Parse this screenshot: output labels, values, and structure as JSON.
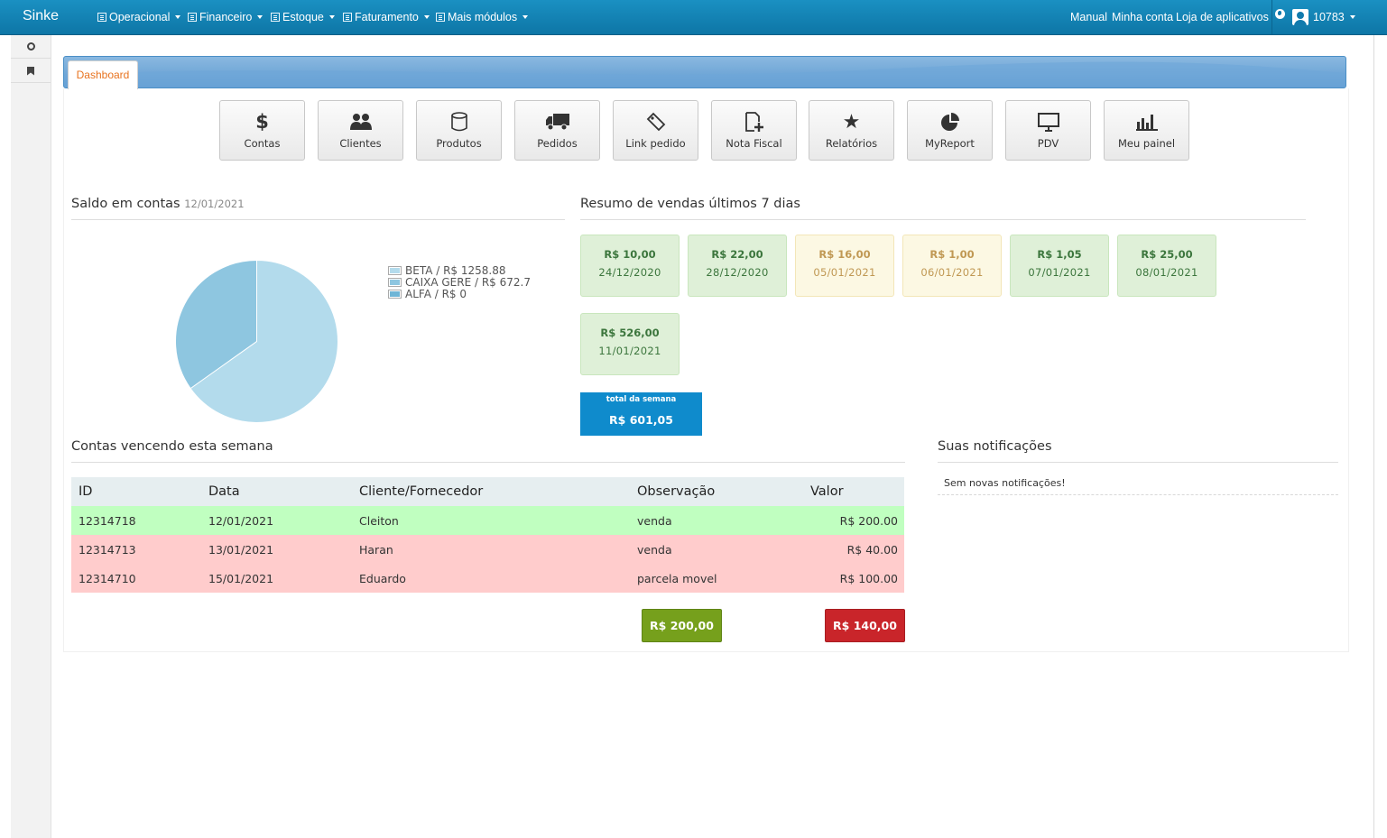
{
  "navbar": {
    "brand": "Sinke",
    "menus": [
      {
        "label": "Operacional"
      },
      {
        "label": "Financeiro"
      },
      {
        "label": "Estoque"
      },
      {
        "label": "Faturamento"
      },
      {
        "label": "Mais módulos"
      }
    ],
    "links": {
      "manual": "Manual",
      "account": "Minha conta",
      "store": "Loja de aplicativos"
    },
    "user": "10783"
  },
  "tabs": {
    "active": "Dashboard"
  },
  "shortcuts": [
    {
      "label": "Contas",
      "icon": "dollar-icon"
    },
    {
      "label": "Clientes",
      "icon": "users-icon"
    },
    {
      "label": "Produtos",
      "icon": "database-icon"
    },
    {
      "label": "Pedidos",
      "icon": "truck-icon"
    },
    {
      "label": "Link pedido",
      "icon": "tag-icon"
    },
    {
      "label": "Nota Fiscal",
      "icon": "file-plus-icon"
    },
    {
      "label": "Relatórios",
      "icon": "star-icon"
    },
    {
      "label": "MyReport",
      "icon": "pie-chart-icon"
    },
    {
      "label": "PDV",
      "icon": "monitor-icon"
    },
    {
      "label": "Meu painel",
      "icon": "bar-chart-icon"
    }
  ],
  "balance": {
    "title": "Saldo em contas",
    "date": "12/01/2021",
    "legend": [
      {
        "label": "BETA / R$ 1258.88",
        "value": 1258.88,
        "color": "#b3dbec"
      },
      {
        "label": "CAIXA GERE / R$ 672.7",
        "value": 672.7,
        "color": "#8ec6e0"
      },
      {
        "label": "ALFA / R$ 0",
        "value": 0,
        "color": "#6fb5d6"
      }
    ]
  },
  "sales": {
    "title": "Resumo de vendas últimos 7 dias",
    "days": [
      {
        "amount": "R$ 10,00",
        "date": "24/12/2020",
        "status": "green"
      },
      {
        "amount": "R$ 22,00",
        "date": "28/12/2020",
        "status": "green"
      },
      {
        "amount": "R$ 16,00",
        "date": "05/01/2021",
        "status": "yellow"
      },
      {
        "amount": "R$ 1,00",
        "date": "06/01/2021",
        "status": "yellow"
      },
      {
        "amount": "R$ 1,05",
        "date": "07/01/2021",
        "status": "green"
      },
      {
        "amount": "R$ 25,00",
        "date": "08/01/2021",
        "status": "green"
      },
      {
        "amount": "R$ 526,00",
        "date": "11/01/2021",
        "status": "green"
      }
    ],
    "week_label": "total da semana",
    "week_total": "R$ 601,05"
  },
  "bills": {
    "title": "Contas vencendo esta semana",
    "headers": {
      "id": "ID",
      "date": "Data",
      "client": "Cliente/Fornecedor",
      "note": "Observação",
      "value": "Valor"
    },
    "rows": [
      {
        "id": "12314718",
        "date": "12/01/2021",
        "client": "Cleiton",
        "note": "venda",
        "value": "R$ 200.00",
        "status": "green"
      },
      {
        "id": "12314713",
        "date": "13/01/2021",
        "client": "Haran",
        "note": "venda",
        "value": "R$ 40.00",
        "status": "red"
      },
      {
        "id": "12314710",
        "date": "15/01/2021",
        "client": "Eduardo",
        "note": "parcela movel",
        "value": "R$ 100.00",
        "status": "red"
      }
    ],
    "total_receivable": "R$ 200,00",
    "total_payable": "R$ 140,00"
  },
  "notifications": {
    "title": "Suas notificações",
    "empty": "Sem novas notificações!"
  },
  "colors": {
    "navbar": "#1183b8",
    "accent_tab": "#e8731f",
    "week_total": "#0f8bcc",
    "total_green": "#76a01c",
    "total_red": "#c9252a"
  }
}
